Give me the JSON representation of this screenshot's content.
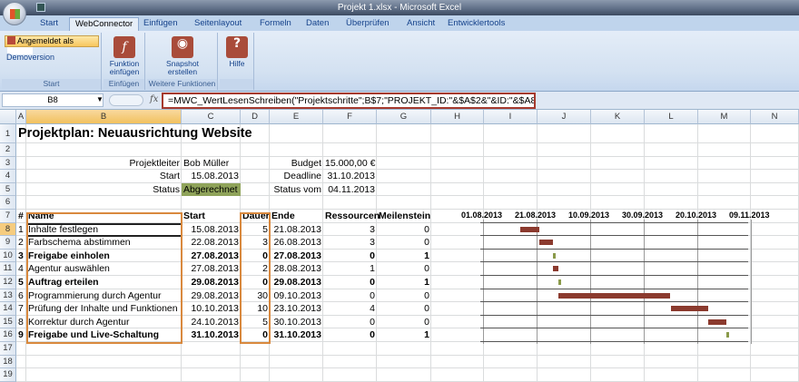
{
  "window": {
    "title": "Projekt 1.xlsx - Microsoft Excel"
  },
  "tabs": [
    "Start",
    "WebConnector",
    "Einfügen",
    "Seitenlayout",
    "Formeln",
    "Daten",
    "Überprüfen",
    "Ansicht",
    "Entwicklertools"
  ],
  "active_tab": "WebConnector",
  "ribbon": {
    "login_label": "Angemeldet als",
    "demo_label": "Demoversion",
    "group_start": "Start",
    "funktion_label": "Funktion einfügen",
    "group_einfuegen": "Einfügen",
    "snapshot_label": "Snapshot erstellen",
    "group_weitere": "Weitere Funktionen",
    "hilfe_label": "Hilfe"
  },
  "formula_bar": {
    "cell": "B8",
    "formula": "=MWC_WertLesenSchreiben(\"Projektschritte\";B$7;\"PROJEKT_ID:\"&$A$2&\"&ID:\"&$A8)"
  },
  "columns": [
    "A",
    "B",
    "C",
    "D",
    "E",
    "F",
    "G",
    "H",
    "I",
    "J",
    "K",
    "L",
    "M",
    "N"
  ],
  "rows": [
    "1",
    "2",
    "3",
    "4",
    "5",
    "6",
    "7",
    "8",
    "9",
    "10",
    "11",
    "12",
    "13",
    "14",
    "15",
    "16",
    "17",
    "18",
    "19"
  ],
  "sheet": {
    "title": "Projektplan: Neuausrichtung Website",
    "projektleiter_label": "Projektleiter",
    "projektleiter": "Bob Müller",
    "start_label": "Start",
    "start": "15.08.2013",
    "status_label": "Status",
    "status": "Abgerechnet",
    "budget_label": "Budget",
    "budget": "15.000,00 €",
    "deadline_label": "Deadline",
    "deadline": "31.10.2013",
    "status_vom_label": "Status vom",
    "status_vom": "04.11.2013",
    "headers": [
      "#",
      "Name",
      "Start",
      "Dauer",
      "Ende",
      "Ressourcen",
      "Meilenstein"
    ],
    "tasks": [
      {
        "id": "1",
        "name": "Inhalte festlegen",
        "start": "15.08.2013",
        "dauer": "5",
        "ende": "21.08.2013",
        "res": "3",
        "ms": "0",
        "bold": false
      },
      {
        "id": "2",
        "name": "Farbschema abstimmen",
        "start": "22.08.2013",
        "dauer": "3",
        "ende": "26.08.2013",
        "res": "3",
        "ms": "0",
        "bold": false
      },
      {
        "id": "3",
        "name": "Freigabe einholen",
        "start": "27.08.2013",
        "dauer": "0",
        "ende": "27.08.2013",
        "res": "0",
        "ms": "1",
        "bold": true
      },
      {
        "id": "4",
        "name": "Agentur auswählen",
        "start": "27.08.2013",
        "dauer": "2",
        "ende": "28.08.2013",
        "res": "1",
        "ms": "0",
        "bold": false
      },
      {
        "id": "5",
        "name": "Auftrag erteilen",
        "start": "29.08.2013",
        "dauer": "0",
        "ende": "29.08.2013",
        "res": "0",
        "ms": "1",
        "bold": true
      },
      {
        "id": "6",
        "name": "Programmierung durch Agentur",
        "start": "29.08.2013",
        "dauer": "30",
        "ende": "09.10.2013",
        "res": "0",
        "ms": "0",
        "bold": false
      },
      {
        "id": "7",
        "name": "Prüfung der Inhalte und Funktionen",
        "start": "10.10.2013",
        "dauer": "10",
        "ende": "23.10.2013",
        "res": "4",
        "ms": "0",
        "bold": false
      },
      {
        "id": "8",
        "name": "Korrektur durch Agentur",
        "start": "24.10.2013",
        "dauer": "5",
        "ende": "30.10.2013",
        "res": "0",
        "ms": "0",
        "bold": false
      },
      {
        "id": "9",
        "name": "Freigabe und Live-Schaltung",
        "start": "31.10.2013",
        "dauer": "0",
        "ende": "31.10.2013",
        "res": "0",
        "ms": "1",
        "bold": true
      }
    ]
  },
  "gantt": {
    "axis_labels": [
      "01.08.2013",
      "21.08.2013",
      "10.09.2013",
      "30.09.2013",
      "20.10.2013",
      "09.11.2013"
    ],
    "bar_color": "#8b3a2e",
    "milestone_color": "#8a9a4a"
  }
}
